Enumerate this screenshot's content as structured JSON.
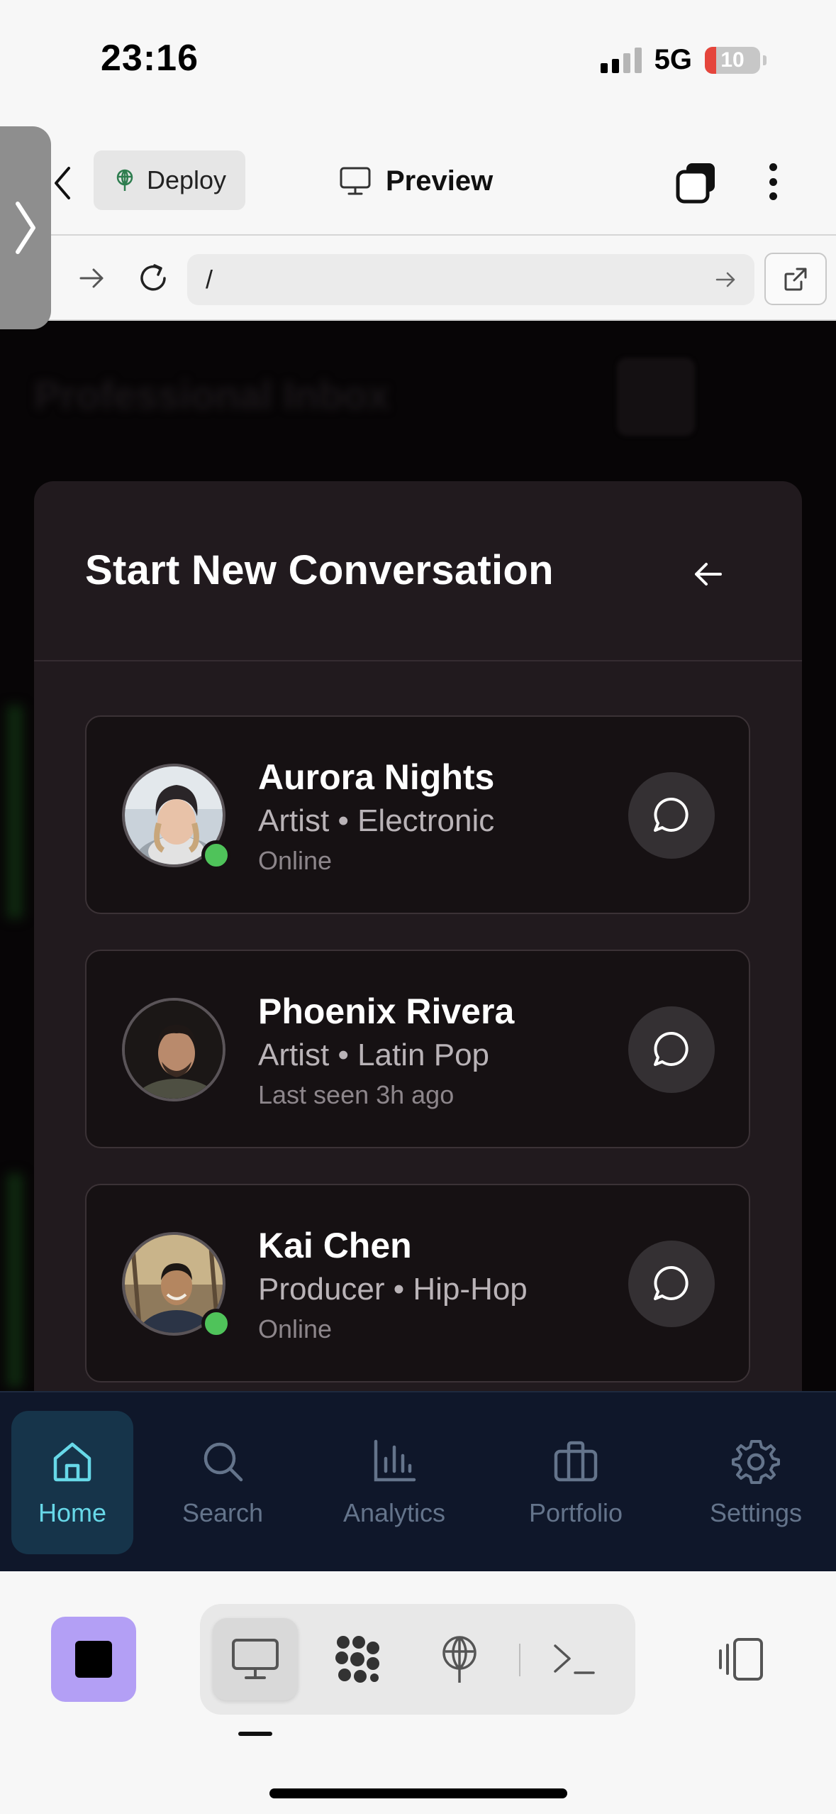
{
  "status_bar": {
    "time": "23:16",
    "network": "5G",
    "battery": "10"
  },
  "browser": {
    "deploy_label": "Deploy",
    "preview_label": "Preview",
    "url_value": "/"
  },
  "app_background": {
    "header_title": "Professional Inbox"
  },
  "modal": {
    "title": "Start New Conversation",
    "contacts": [
      {
        "name": "Aurora Nights",
        "role": "Artist • Electronic",
        "status": "Online",
        "online": true
      },
      {
        "name": "Phoenix Rivera",
        "role": "Artist • Latin Pop",
        "status": "Last seen 3h ago",
        "online": false
      },
      {
        "name": "Kai Chen",
        "role": "Producer • Hip-Hop",
        "status": "Online",
        "online": true
      }
    ]
  },
  "nav": {
    "items": [
      {
        "label": "Home",
        "icon": "home-icon",
        "active": true
      },
      {
        "label": "Search",
        "icon": "search-icon"
      },
      {
        "label": "Analytics",
        "icon": "analytics-icon"
      },
      {
        "label": "Portfolio",
        "icon": "briefcase-icon"
      },
      {
        "label": "Settings",
        "icon": "gear-icon"
      }
    ]
  },
  "colors": {
    "modal_bg": "#211a1e",
    "nav_bg": "#0f172a",
    "nav_active": "#67d8e8",
    "online": "#4fc35a",
    "stop_button": "#b39ff5"
  }
}
